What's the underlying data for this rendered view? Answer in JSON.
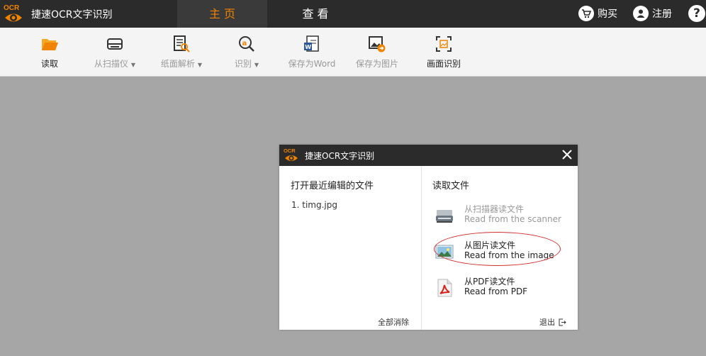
{
  "app": {
    "logo_text": "OCR",
    "title": "捷速OCR文字识别",
    "accent_color": "#f08300"
  },
  "tabs": [
    {
      "label": "主 页",
      "active": true
    },
    {
      "label": "查 看",
      "active": false
    }
  ],
  "top_right": {
    "buy_label": "购买",
    "register_label": "注册",
    "help_label": "?"
  },
  "toolbar": {
    "items": [
      {
        "label": "读取",
        "icon": "folder-open-icon",
        "enabled": true,
        "dropdown": false
      },
      {
        "label": "从扫描仪",
        "icon": "scanner-icon",
        "enabled": false,
        "dropdown": true
      },
      {
        "label": "纸面解析",
        "icon": "page-analyze-icon",
        "enabled": false,
        "dropdown": true
      },
      {
        "label": "识别",
        "icon": "recognize-icon",
        "enabled": false,
        "dropdown": true
      },
      {
        "label": "保存为Word",
        "icon": "word-doc-icon",
        "enabled": false,
        "dropdown": false
      },
      {
        "label": "保存为图片",
        "icon": "save-image-icon",
        "enabled": false,
        "dropdown": false
      },
      {
        "label": "画面识别",
        "icon": "screen-capture-icon",
        "enabled": true,
        "dropdown": false
      }
    ],
    "caret": "▼"
  },
  "dialog": {
    "title": "捷速OCR文字识别",
    "recent_title": "打开最近编辑的文件",
    "recent_files": [
      "1.  timg.jpg"
    ],
    "clear_all_label": "全部消除",
    "read_title": "读取文件",
    "sources": [
      {
        "label_cn": "从扫描器读文件",
        "label_en": "Read from the scanner",
        "enabled": false
      },
      {
        "label_cn": "从图片读文件",
        "label_en": "Read from the image",
        "enabled": true,
        "highlighted": true
      },
      {
        "label_cn": "从PDF读文件",
        "label_en": "Read from PDF",
        "enabled": true
      }
    ],
    "exit_label": "退出"
  }
}
